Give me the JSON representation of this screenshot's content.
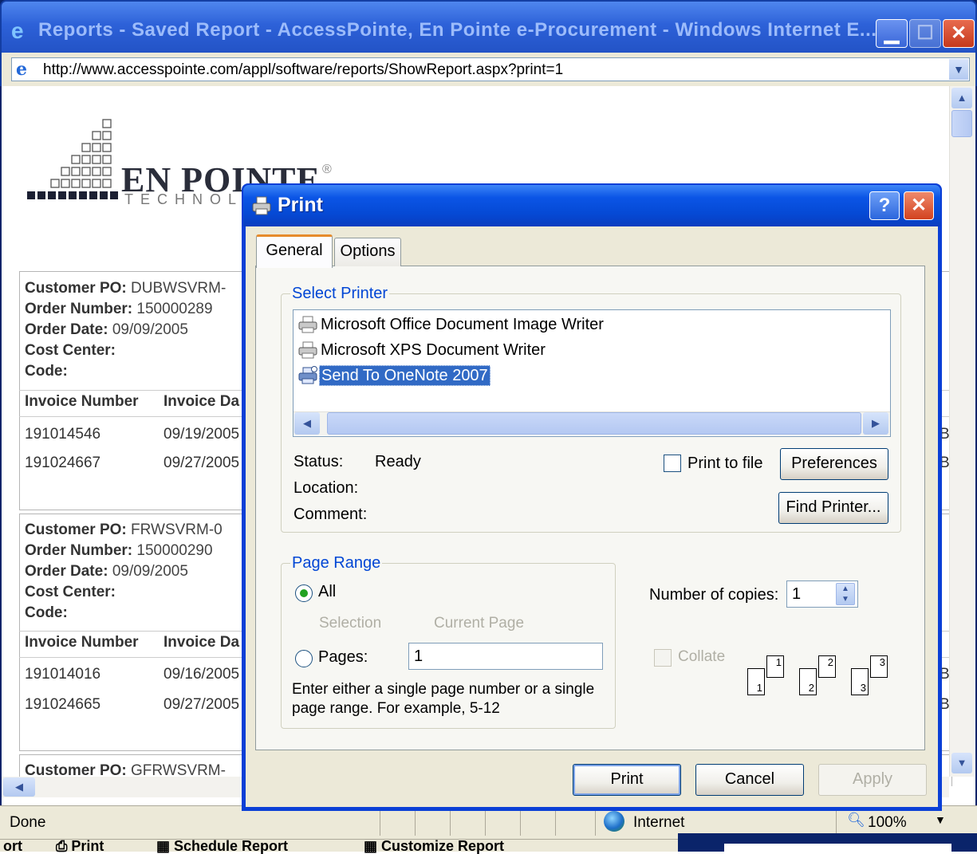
{
  "ie": {
    "title": "Reports - Saved Report - AccessPointe, En Pointe e-Procurement - Windows Internet E...",
    "url": "http://www.accesspointe.com/appl/software/reports/ShowReport.aspx?print=1",
    "status": "Done",
    "zone": "Internet",
    "zoom": "100%",
    "icons": {
      "ie": "ie-logo-icon",
      "minimize": "minimize-icon",
      "maximize": "maximize-icon",
      "close": "close-icon"
    }
  },
  "logo": {
    "name": "EN POINTE",
    "reg": "®",
    "sub": "TECHNOL"
  },
  "report": {
    "blocks": [
      {
        "customer_po_label": "Customer PO:",
        "customer_po": "DUBWSVRM-",
        "order_number_label": "Order Number:",
        "order_number": "150000289",
        "order_date_label": "Order Date:",
        "order_date": "09/09/2005",
        "cost_center_label": "Cost Center:",
        "code_label": "Code:",
        "col_invoice_number": "Invoice Number",
        "col_invoice_date": "Invoice Da",
        "rows": [
          {
            "invoice_number": "191014546",
            "invoice_date": "09/19/2005",
            "right": "Bi"
          },
          {
            "invoice_number": "191024667",
            "invoice_date": "09/27/2005",
            "right": "Bi"
          }
        ]
      },
      {
        "customer_po_label": "Customer PO:",
        "customer_po": "FRWSVRM-0",
        "order_number_label": "Order Number:",
        "order_number": "150000290",
        "order_date_label": "Order Date:",
        "order_date": "09/09/2005",
        "cost_center_label": "Cost Center:",
        "code_label": "Code:",
        "col_invoice_number": "Invoice Number",
        "col_invoice_date": "Invoice Da",
        "rows": [
          {
            "invoice_number": "191014016",
            "invoice_date": "09/16/2005",
            "right": "Bi"
          },
          {
            "invoice_number": "191024665",
            "invoice_date": "09/27/2005",
            "right": "Bi"
          }
        ]
      }
    ],
    "partial_customer_po_label": "Customer PO:",
    "partial_customer_po": "GFRWSVRM-"
  },
  "bottom_strip": {
    "items": [
      "ort",
      "Print",
      "Schedule Report",
      "Customize Report"
    ]
  },
  "print_dialog": {
    "title": "Print",
    "help": "?",
    "close": "✕",
    "tabs": {
      "general": "General",
      "options": "Options"
    },
    "select_printer": {
      "title": "Select Printer",
      "printers": [
        {
          "name": "Microsoft Office Document Image Writer",
          "selected": false
        },
        {
          "name": "Microsoft XPS Document Writer",
          "selected": false
        },
        {
          "name": "Send To OneNote 2007",
          "selected": true
        }
      ],
      "status_label": "Status:",
      "status_value": "Ready",
      "location_label": "Location:",
      "comment_label": "Comment:",
      "print_to_file": "Print to file",
      "preferences": "Preferences",
      "find_printer": "Find Printer..."
    },
    "page_range": {
      "title": "Page Range",
      "all": "All",
      "selection": "Selection",
      "current_page": "Current Page",
      "pages": "Pages:",
      "pages_value": "1",
      "hint": "Enter either a single page number or a single page range.  For example, 5-12"
    },
    "copies": {
      "label": "Number of copies:",
      "value": "1",
      "collate": "Collate",
      "collate_pages": [
        {
          "front": "1",
          "back": "1"
        },
        {
          "front": "2",
          "back": "2"
        },
        {
          "front": "3",
          "back": "3"
        }
      ]
    },
    "buttons": {
      "print": "Print",
      "cancel": "Cancel",
      "apply": "Apply"
    }
  }
}
